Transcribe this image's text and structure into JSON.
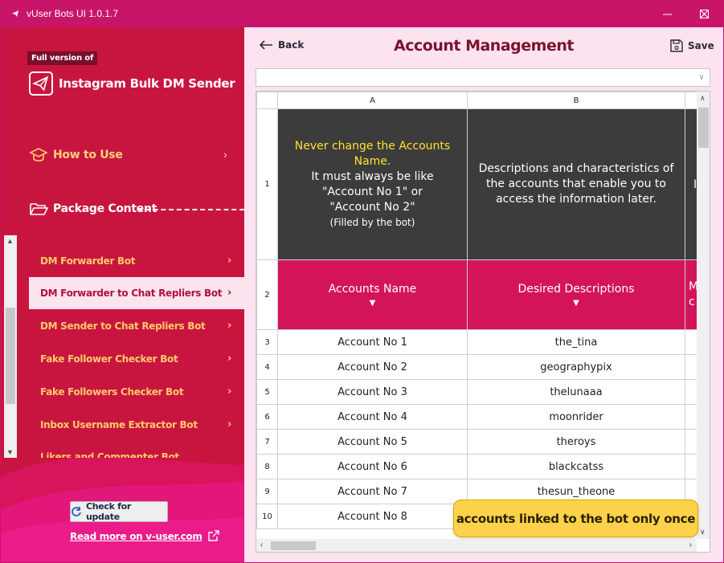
{
  "window": {
    "title": "vUser Bots UI 1.0.1.7",
    "accent_color": "#c8156a"
  },
  "sidebar": {
    "badge": "Full version of",
    "app_name": "Instagram Bulk DM Sender",
    "sections": [
      {
        "label": "How to Use",
        "icon": "graduation-cap-icon"
      },
      {
        "label": "Package Content",
        "icon": "folder-open-icon"
      }
    ],
    "items": [
      {
        "label": "DM Forwarder Bot"
      },
      {
        "label": "DM Forwarder to Chat Repliers Bot",
        "active": true
      },
      {
        "label": "DM Sender to Chat Repliers Bot"
      },
      {
        "label": "Fake Follower Checker Bot"
      },
      {
        "label": "Fake Followers Checker Bot"
      },
      {
        "label": "Inbox Username Extractor Bot"
      },
      {
        "label": "Likers and Commenter Bot"
      }
    ],
    "check_update": "Check for update",
    "read_more": "Read more on v-user.com"
  },
  "main": {
    "back_label": "Back",
    "title": "Account Management",
    "save_label": "Save",
    "combo_value": ""
  },
  "sheet": {
    "columns": [
      "A",
      "B"
    ],
    "row1": {
      "a_yellow": "Never change the Accounts Name.",
      "a_line2": "It must always be like",
      "a_line3": "\"Account No 1\" or",
      "a_line4": "\"Account No 2\"",
      "a_line5": "(Filled by the bot)",
      "b_text": "Descriptions and characteristics of the accounts that enable you to access the information later.",
      "c_partial": "I l"
    },
    "row2": {
      "a_header": "Accounts Name",
      "b_header": "Desired Descriptions",
      "c_partial": "M c"
    },
    "rows": [
      {
        "num": "3",
        "account": "Account No 1",
        "desc": "the_tina"
      },
      {
        "num": "4",
        "account": "Account No 2",
        "desc": "geographypix"
      },
      {
        "num": "5",
        "account": "Account No 3",
        "desc": "thelunaaa"
      },
      {
        "num": "6",
        "account": "Account No 4",
        "desc": "moonrider"
      },
      {
        "num": "7",
        "account": "Account No 5",
        "desc": "theroys"
      },
      {
        "num": "8",
        "account": "Account No 6",
        "desc": "blackcatss"
      },
      {
        "num": "9",
        "account": "Account No 7",
        "desc": "thesun_theone"
      },
      {
        "num": "10",
        "account": "Account No 8",
        "desc": ""
      }
    ]
  },
  "toast": "accounts linked to the bot only once"
}
